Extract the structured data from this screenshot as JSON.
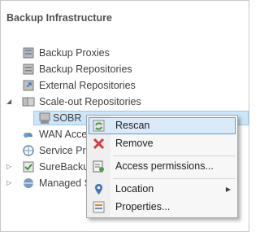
{
  "panel": {
    "title": "Backup Infrastructure"
  },
  "tree": {
    "backup_proxies": "Backup Proxies",
    "backup_repositories": "Backup Repositories",
    "external_repositories": "External Repositories",
    "scaleout_repositories": "Scale-out Repositories",
    "sobr": "SOBR",
    "wan_accelerators": "WAN Accel",
    "service_providers": "Service Prov",
    "surebackup": "SureBackup",
    "managed_servers": "Managed S"
  },
  "context_menu": {
    "rescan": "Rescan",
    "remove": "Remove",
    "access_permissions": "Access permissions...",
    "location": "Location",
    "properties": "Properties..."
  },
  "colors": {
    "selection": "#cce5f8",
    "menu_highlight": "#daeaf8",
    "remove_red": "#d23c3c"
  },
  "icons": {
    "backup_proxies": "proxy-icon",
    "backup_repositories": "repository-icon",
    "external_repositories": "external-repository-icon",
    "scaleout_repositories": "scaleout-repository-icon",
    "sobr": "sobr-icon",
    "wan": "wan-accelerator-icon",
    "service_providers": "service-provider-icon",
    "surebackup": "surebackup-icon",
    "managed": "managed-servers-icon",
    "rescan": "rescan-icon",
    "remove": "remove-icon",
    "access": "access-permissions-icon",
    "location": "location-icon",
    "properties": "properties-icon"
  }
}
